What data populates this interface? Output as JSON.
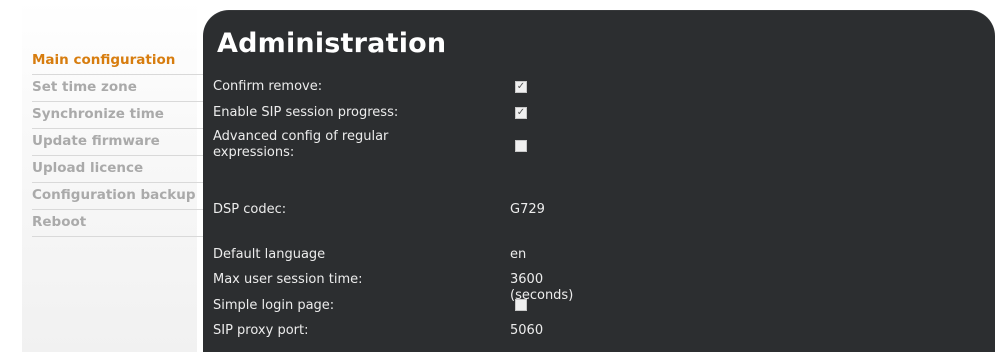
{
  "sidebar": {
    "items": [
      {
        "label": "Main configuration",
        "active": true
      },
      {
        "label": "Set time zone",
        "active": false
      },
      {
        "label": "Synchronize time",
        "active": false
      },
      {
        "label": "Update firmware",
        "active": false
      },
      {
        "label": "Upload licence",
        "active": false
      },
      {
        "label": "Configuration backup",
        "active": false
      },
      {
        "label": "Reboot",
        "active": false
      }
    ]
  },
  "panel": {
    "title": "Administration",
    "fields": {
      "confirm_remove": {
        "label": "Confirm remove:",
        "checked": true
      },
      "enable_sip_progress": {
        "label": "Enable SIP session progress:",
        "checked": true
      },
      "advanced_regex": {
        "label": "Advanced config of regular expressions:",
        "checked": false
      },
      "dsp_codec": {
        "label": "DSP codec:",
        "value": "G729"
      },
      "default_language": {
        "label": "Default language",
        "value": "en"
      },
      "max_session_time": {
        "label": "Max user session time:",
        "value": "3600 (seconds)"
      },
      "simple_login": {
        "label": "Simple login page:",
        "checked": false
      },
      "sip_proxy_port": {
        "label": "SIP proxy port:",
        "value": "5060"
      }
    }
  },
  "colors": {
    "accent": "#d77d0f",
    "nav_inactive": "#aaaaaa",
    "panel_bg": "#2c2e30"
  },
  "icons": {
    "checked": "check-mark-icon"
  }
}
